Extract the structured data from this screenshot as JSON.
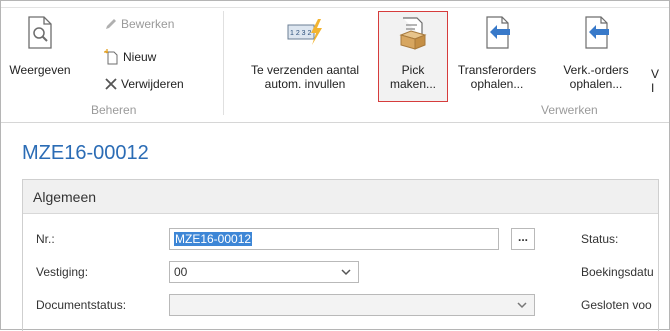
{
  "ribbon": {
    "beheren": {
      "weergeven_label": "Weergeven",
      "bewerken_label": "Bewerken",
      "nieuw_label": "Nieuw",
      "verwijderen_label": "Verwijderen",
      "group_label": "Beheren"
    },
    "verwerken": {
      "te_verzenden_line1": "Te verzenden aantal",
      "te_verzenden_line2": "autom. invullen",
      "te_verzenden_icon_text": "1 2 3 2",
      "pick_line1": "Pick",
      "pick_line2": "maken...",
      "transfer_line1": "Transferorders",
      "transfer_line2": "ophalen...",
      "verkorders_line1": "Verk.-orders",
      "verkorders_line2": "ophalen...",
      "partial_line1": "V",
      "partial_line2": "I",
      "group_label": "Verwerken"
    }
  },
  "page": {
    "title": "MZE16-00012"
  },
  "algemeen": {
    "header": "Algemeen",
    "nr_label": "Nr.:",
    "nr_value": "MZE16-00012",
    "lookup_label": "...",
    "vestiging_label": "Vestiging:",
    "vestiging_value": "00",
    "documentstatus_label": "Documentstatus:",
    "documentstatus_value": "",
    "status_label": "Status:",
    "boekingsdatum_label": "Boekingsdatu",
    "gesloten_label": "Gesloten voo"
  },
  "colors": {
    "accent": "#2b6cb5",
    "selection": "#3d86d6",
    "highlight_border": "#d63c3c"
  }
}
